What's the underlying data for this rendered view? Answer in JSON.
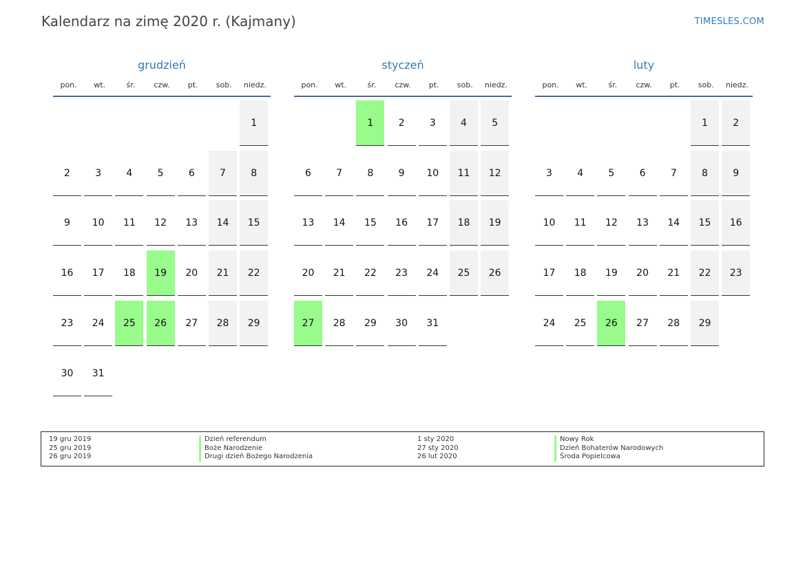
{
  "title": "Kalendarz na zimę 2020 r. (Kajmany)",
  "site": "TIMESLES.COM",
  "weekday_labels": [
    "pon.",
    "wt.",
    "śr.",
    "czw.",
    "pt.",
    "sob.",
    "niedz."
  ],
  "months": [
    {
      "name": "grudzień",
      "weeks": [
        [
          "",
          "",
          "",
          "",
          "",
          "",
          "1"
        ],
        [
          "2",
          "3",
          "4",
          "5",
          "6",
          "7",
          "8"
        ],
        [
          "9",
          "10",
          "11",
          "12",
          "13",
          "14",
          "15"
        ],
        [
          "16",
          "17",
          "18",
          "19",
          "20",
          "21",
          "22"
        ],
        [
          "23",
          "24",
          "25",
          "26",
          "27",
          "28",
          "29"
        ],
        [
          "30",
          "31",
          "",
          "",
          "",
          "",
          ""
        ]
      ],
      "holidays": [
        "19",
        "25",
        "26"
      ]
    },
    {
      "name": "styczeń",
      "weeks": [
        [
          "",
          "",
          "1",
          "2",
          "3",
          "4",
          "5"
        ],
        [
          "6",
          "7",
          "8",
          "9",
          "10",
          "11",
          "12"
        ],
        [
          "13",
          "14",
          "15",
          "16",
          "17",
          "18",
          "19"
        ],
        [
          "20",
          "21",
          "22",
          "23",
          "24",
          "25",
          "26"
        ],
        [
          "27",
          "28",
          "29",
          "30",
          "31",
          "",
          ""
        ]
      ],
      "holidays": [
        "1",
        "27"
      ]
    },
    {
      "name": "luty",
      "weeks": [
        [
          "",
          "",
          "",
          "",
          "",
          "1",
          "2"
        ],
        [
          "3",
          "4",
          "5",
          "6",
          "7",
          "8",
          "9"
        ],
        [
          "10",
          "11",
          "12",
          "13",
          "14",
          "15",
          "16"
        ],
        [
          "17",
          "18",
          "19",
          "20",
          "21",
          "22",
          "23"
        ],
        [
          "24",
          "25",
          "26",
          "27",
          "28",
          "29",
          ""
        ]
      ],
      "holidays": [
        "26"
      ]
    }
  ],
  "legend": {
    "left": {
      "dates": [
        "19 gru 2019",
        "25 gru 2019",
        "26 gru 2019"
      ],
      "names": [
        "Dzień referendum",
        "Boże Narodzenie",
        "Drugi dzień Bożego Narodzenia"
      ]
    },
    "right": {
      "dates": [
        "1 sty 2020",
        "27 sty 2020",
        "26 lut 2020"
      ],
      "names": [
        "Nowy Rok",
        "Dzień Bohaterów Narodowych",
        "Środa Popielcowa"
      ]
    }
  },
  "colors": {
    "accent": "#2f7bbd",
    "holiday": "#98fb8c",
    "weekend": "#f2f2f2",
    "header_rule": "#4a6b8c"
  }
}
